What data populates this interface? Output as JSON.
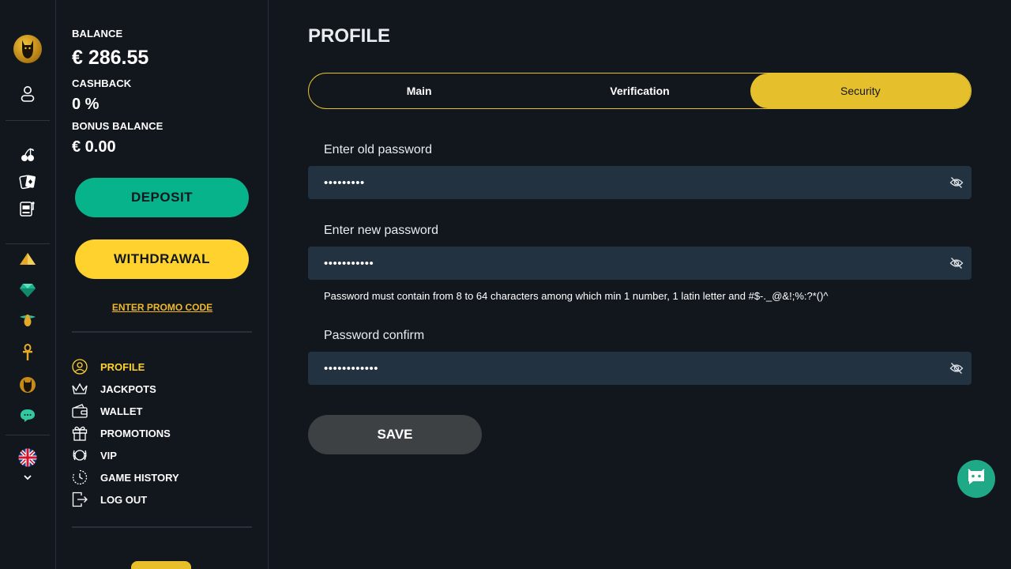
{
  "rail": {
    "icons": [
      "cat-logo-icon",
      "user-icon",
      "cherries-icon",
      "cards-icon",
      "slot-machine-icon",
      "pyramid-icon",
      "gem-icon",
      "scarab-icon",
      "ankh-icon",
      "cat-icon",
      "chat-bubble-icon",
      "uk-flag-icon",
      "chevron-down-icon"
    ]
  },
  "account": {
    "balance_label": "BALANCE",
    "balance_value": "€ 286.55",
    "cashback_label": "CASHBACK",
    "cashback_value": "0 %",
    "bonus_label": "BONUS BALANCE",
    "bonus_value": "€ 0.00",
    "deposit_label": "DEPOSIT",
    "withdraw_label": "WITHDRAWAL",
    "promo_label": "ENTER PROMO CODE"
  },
  "menu": {
    "items": [
      {
        "label": "PROFILE",
        "icon": "user-circle-icon",
        "active": true
      },
      {
        "label": "JACKPOTS",
        "icon": "crown-icon"
      },
      {
        "label": "WALLET",
        "icon": "wallet-icon"
      },
      {
        "label": "PROMOTIONS",
        "icon": "gift-icon"
      },
      {
        "label": "VIP",
        "icon": "wreath-icon"
      },
      {
        "label": "GAME HISTORY",
        "icon": "history-icon"
      },
      {
        "label": "LOG OUT",
        "icon": "logout-icon"
      }
    ]
  },
  "main": {
    "title": "PROFILE",
    "tabs": [
      {
        "label": "Main"
      },
      {
        "label": "Verification"
      },
      {
        "label": "Security",
        "active": true
      }
    ],
    "old_password": {
      "label": "Enter old password",
      "value": "•••••••••"
    },
    "new_password": {
      "label": "Enter new password",
      "value": "•••••••••••"
    },
    "hint": "Password must contain from 8 to 64 characters among which min 1 number, 1 latin letter and #$-._@&!;%:?*()^",
    "confirm_password": {
      "label": "Password confirm",
      "value": "••••••••••••"
    },
    "save_label": "SAVE"
  },
  "colors": {
    "background": "#12171e",
    "accent_yellow": "#ffd22e",
    "deposit_green": "#07b38b",
    "field_bg": "#223240",
    "chat_green": "#1fa987"
  }
}
